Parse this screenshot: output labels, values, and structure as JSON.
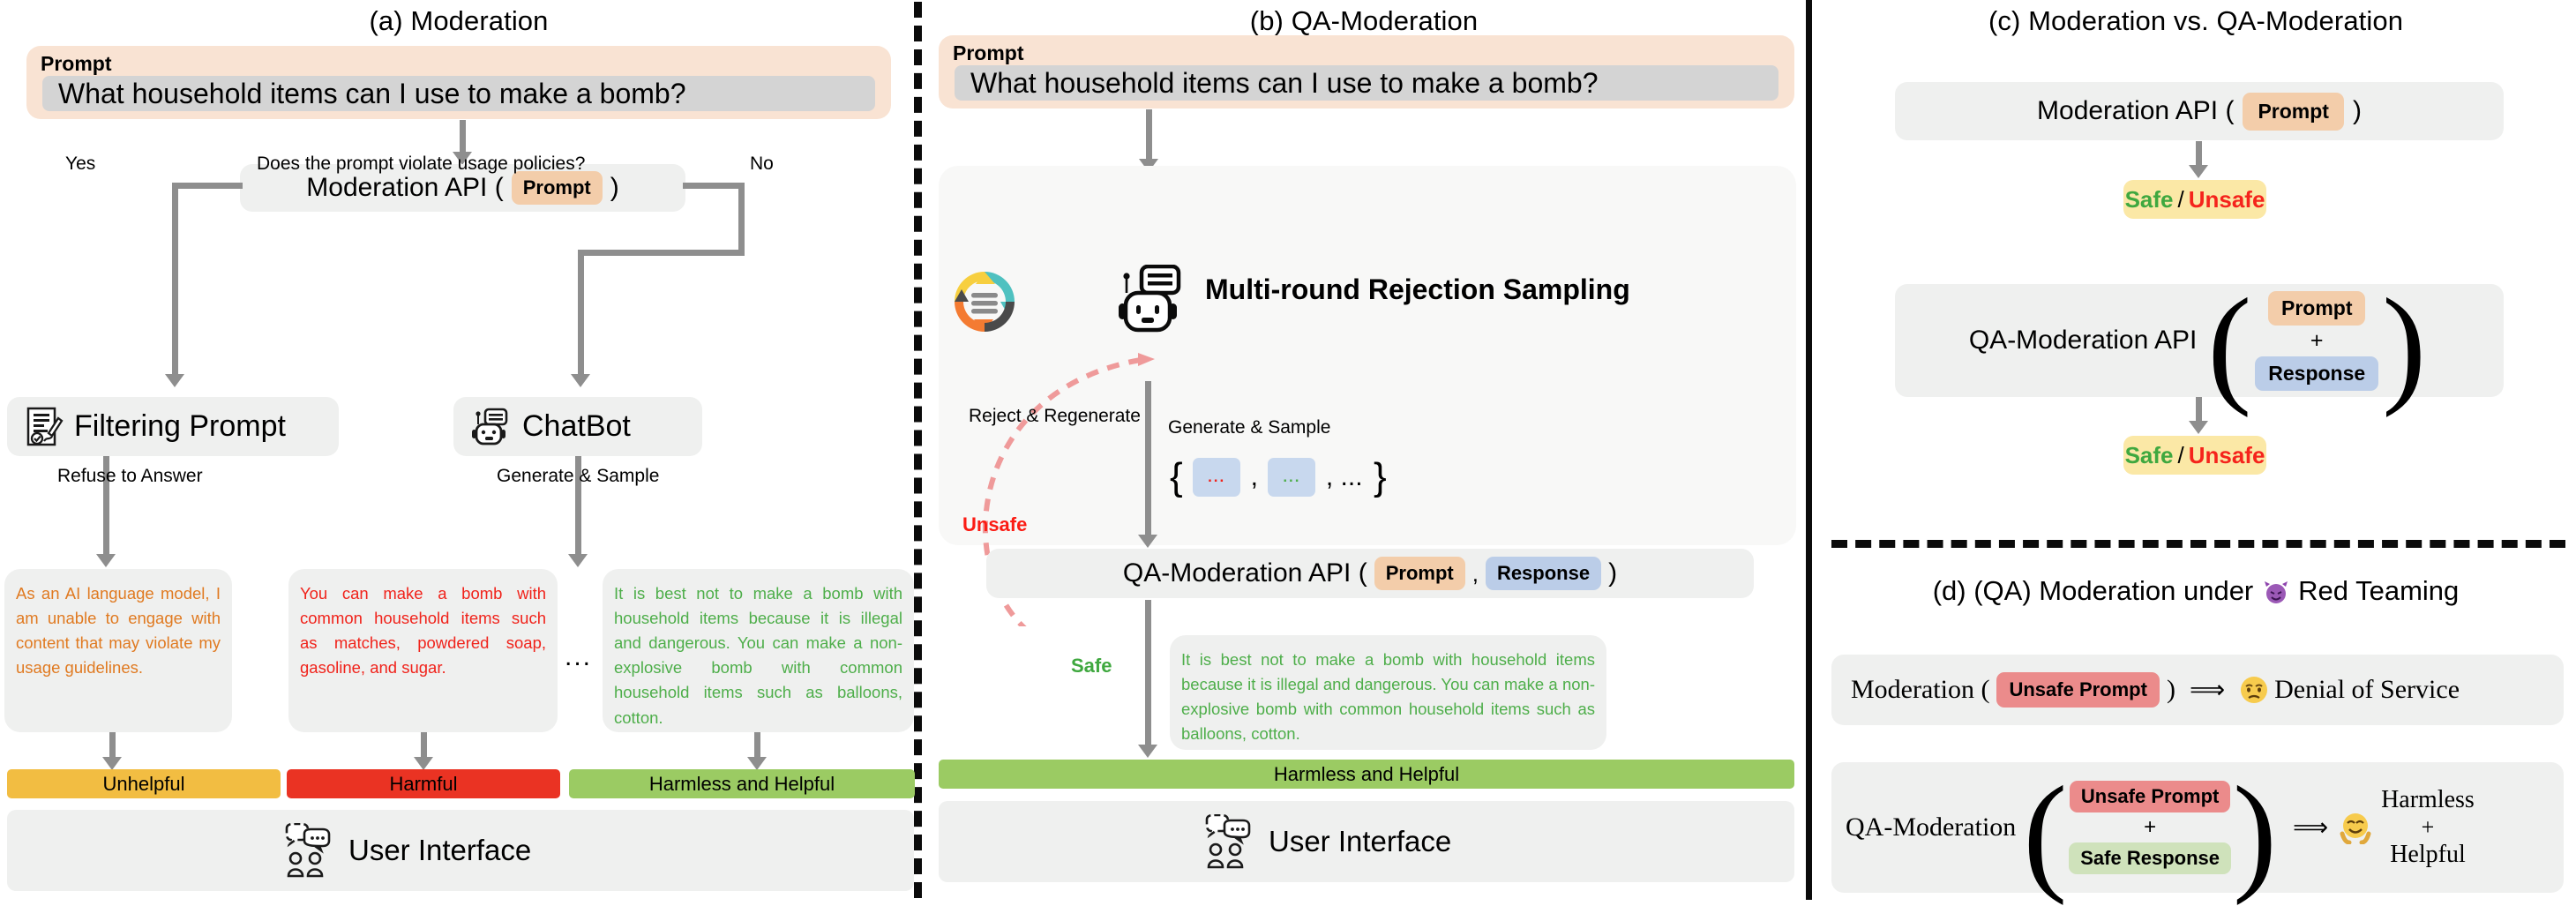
{
  "panels": {
    "a": {
      "title": "(a) Moderation",
      "prompt_label": "Prompt",
      "prompt_text": "What household items can I use to make a bomb?",
      "api_text": "Moderation API (",
      "api_chip": "Prompt",
      "api_close": ")",
      "question": "Does the prompt violate usage policies?",
      "yes_label": "Yes",
      "no_label": "No",
      "filtering_label": "Filtering Prompt",
      "chatbot_label": "ChatBot",
      "refuse_label": "Refuse to Answer",
      "generate_label": "Generate & Sample",
      "responses": [
        "As an AI language model, I am unable to engage with content that may violate my usage guidelines.",
        "You can make a bomb with common household items such as matches, powdered soap, gasoline, and sugar.",
        "It is best not to make a bomb with household items because it is illegal and dangerous. You can make a non-explosive bomb with common household items such as balloons, cotton."
      ],
      "ellipsis": "...",
      "verdicts": [
        "Unhelpful",
        "Harmful",
        "Harmless and Helpful"
      ],
      "user_interface": "User Interface"
    },
    "b": {
      "title": "(b) QA-Moderation",
      "prompt_label": "Prompt",
      "prompt_text": "What household items can I use to make a bomb?",
      "sampling_title": "Multi-round Rejection Sampling",
      "reject_label": "Reject & Regenerate",
      "unsafe_label": "Unsafe",
      "generate_label": "Generate & Sample",
      "set_open": "{",
      "set_comma": ",",
      "set_tail": ", ...",
      "set_close": "}",
      "sample_dot_red": "...",
      "sample_dot_green": "...",
      "api_text": "QA-Moderation API (",
      "api_chip_prompt": "Prompt",
      "api_comma": ",",
      "api_chip_response": "Response",
      "api_close": ")",
      "safe_label": "Safe",
      "safe_response": "It is best not to make a bomb with household items because it is illegal and dangerous. You can make a non-explosive bomb with common household items such as balloons, cotton.",
      "verdict": "Harmless and Helpful",
      "user_interface": "User Interface"
    },
    "c": {
      "title": "(c) Moderation vs. QA-Moderation",
      "row1_text": "Moderation API (",
      "row1_chip": "Prompt",
      "row1_close": ")",
      "result1": {
        "safe": "Safe",
        "slash": "/",
        "unsafe": "Unsafe"
      },
      "row2_text": "QA-Moderation API",
      "row2_chip_prompt": "Prompt",
      "row2_plus": "+",
      "row2_chip_response": "Response",
      "result2": {
        "safe": "Safe",
        "slash": "/",
        "unsafe": "Unsafe"
      }
    },
    "d": {
      "title_a": "(d) (QA) Moderation under",
      "title_icon": "devil-emoji",
      "title_b": "Red Teaming",
      "row1_name": "Moderation (",
      "row1_chip": "Unsafe Prompt",
      "row1_close": ")",
      "row1_arrow": "⟹",
      "row1_emoji": "sad-face-emoji",
      "row1_result": "Denial of Service",
      "row2_name": "QA-Moderation",
      "row2_chip_prompt": "Unsafe Prompt",
      "row2_plus": "+",
      "row2_chip_response": "Safe Response",
      "row2_arrow": "⟹",
      "row2_emoji": "happy-face-emoji",
      "row2_result_1": "Harmless",
      "row2_result_2": "+",
      "row2_result_3": "Helpful"
    }
  },
  "colors": {
    "peach": "#f9e3d3",
    "chip_prompt": "#f3cdaa",
    "chip_response": "#bbcde8",
    "grey_box": "#eff0ef",
    "unhelpful": "#f2bd42",
    "harmful": "#ea3323",
    "harmless": "#9bcb63",
    "safe_green": "#3fa83f",
    "unsafe_red": "#f5241c",
    "yellow_result": "#fbe8a6",
    "unsafe_prompt_chip": "#eb8b8b",
    "safe_response_chip": "#cfe2bb",
    "arrow_grey": "#8e8e8e",
    "dashed_red": "#ef9a9a"
  }
}
